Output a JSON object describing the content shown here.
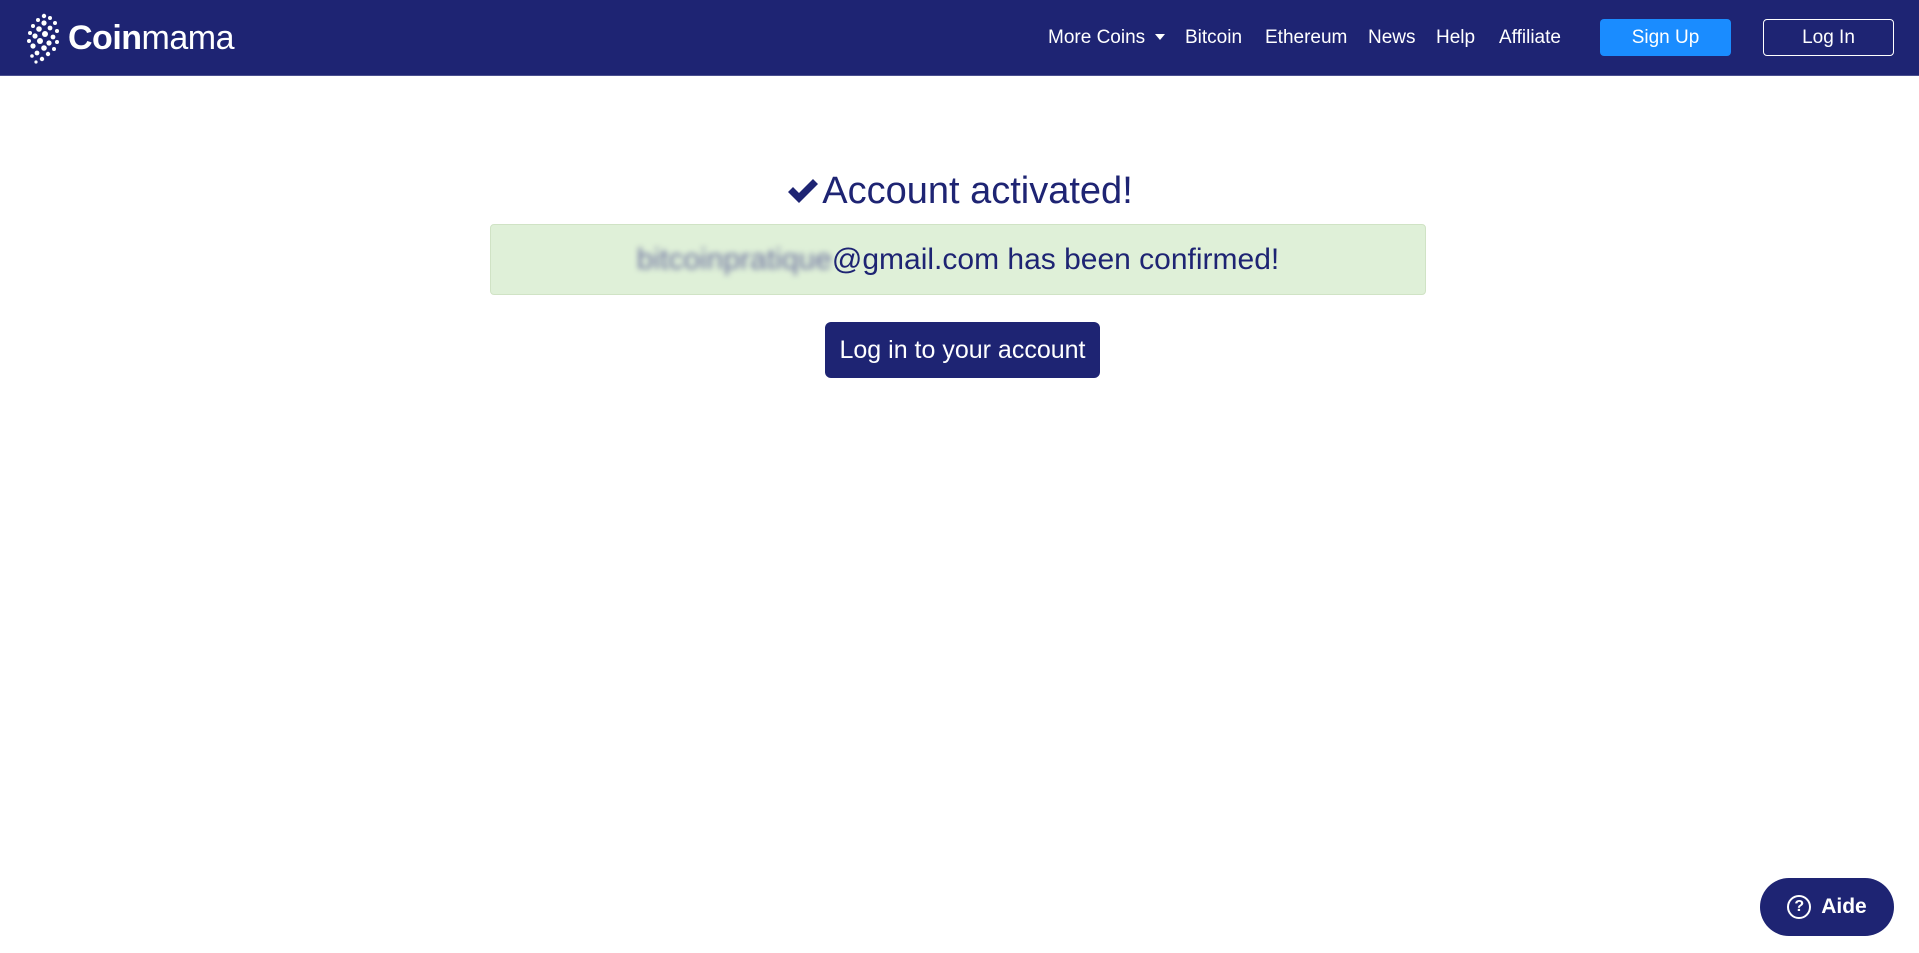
{
  "header": {
    "logo": {
      "bold": "Coin",
      "regular": "mama"
    },
    "nav": [
      {
        "label": "More Coins",
        "has_dropdown": true
      },
      {
        "label": "Bitcoin"
      },
      {
        "label": "Ethereum"
      },
      {
        "label": "News"
      },
      {
        "label": "Help"
      },
      {
        "label": "Affiliate"
      }
    ],
    "signup_label": "Sign Up",
    "login_label": "Log In"
  },
  "main": {
    "title": "Account activated!",
    "title_icon": "check-icon",
    "alert": {
      "email_local_part": "bitcoinpratique",
      "message_rest": "@gmail.com has been confirmed!"
    },
    "cta_label": "Log in to your account"
  },
  "help_widget": {
    "label": "Aide",
    "icon": "question-icon"
  },
  "colors": {
    "brand_navy": "#1e2473",
    "signup_blue": "#1a8cff",
    "alert_green": "#dff0d8"
  }
}
